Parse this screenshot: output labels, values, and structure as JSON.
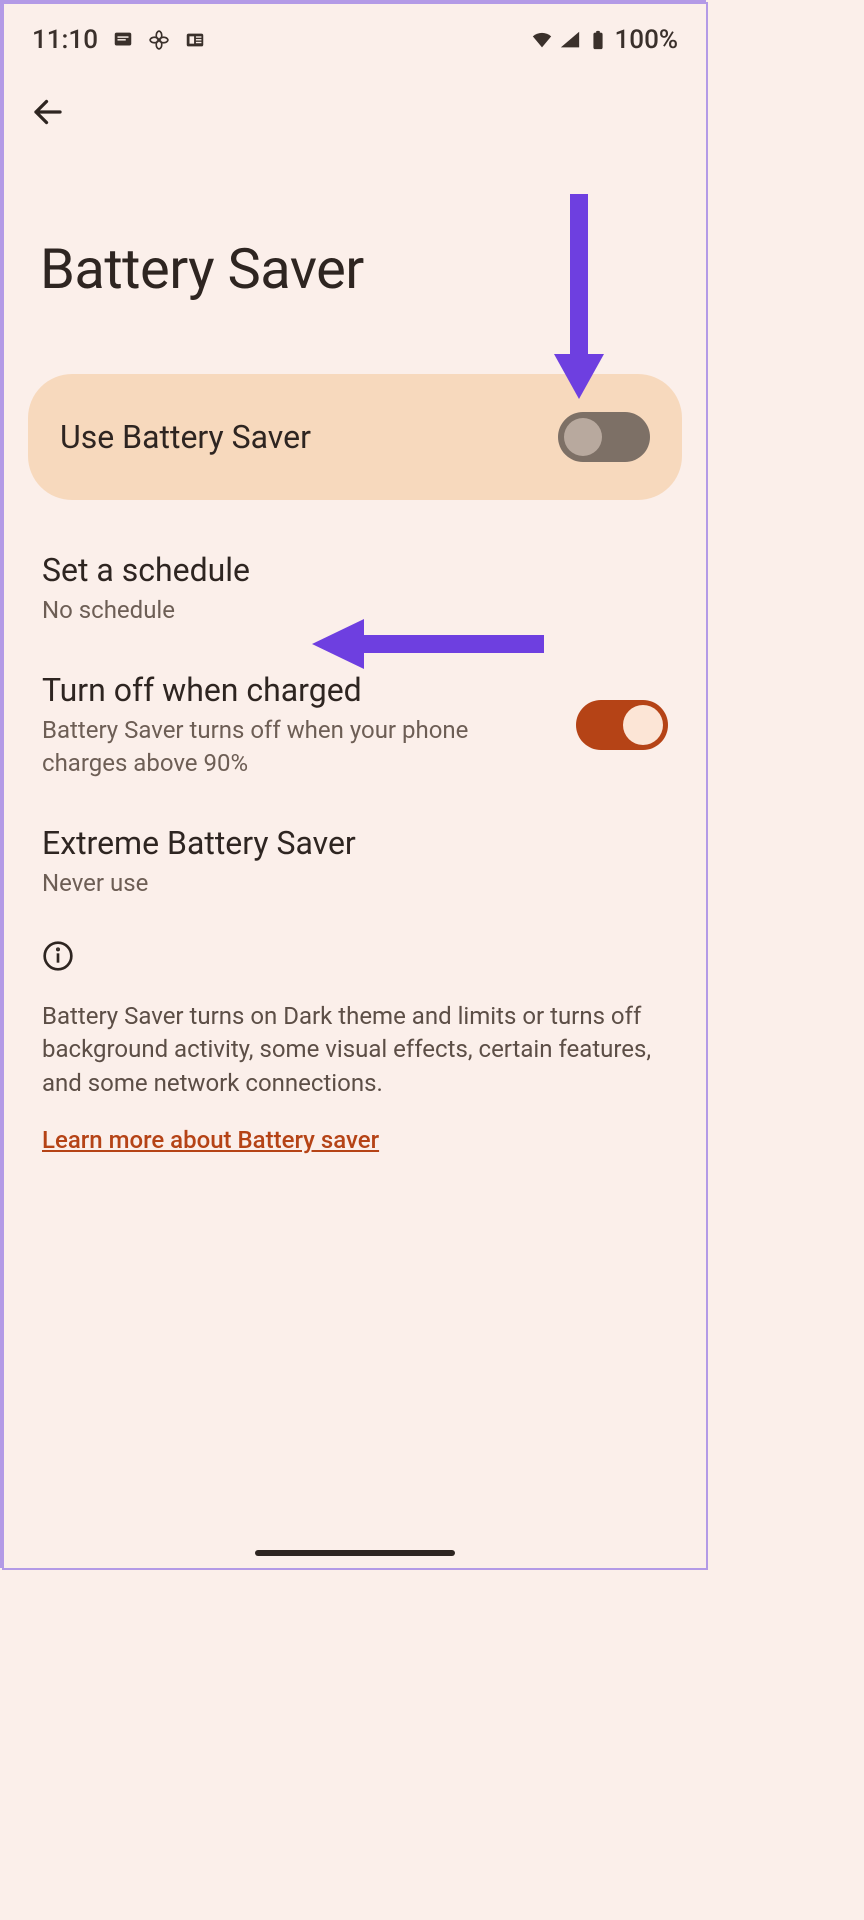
{
  "status": {
    "time": "11:10",
    "battery": "100%"
  },
  "header": {
    "title": "Battery Saver"
  },
  "main_toggle": {
    "label": "Use Battery Saver",
    "on": false
  },
  "items": {
    "schedule": {
      "title": "Set a schedule",
      "sub": "No schedule"
    },
    "turnoff": {
      "title": "Turn off when charged",
      "sub": "Battery Saver turns off when your phone charges above 90%",
      "on": true
    },
    "extreme": {
      "title": "Extreme Battery Saver",
      "sub": "Never use"
    }
  },
  "info": {
    "text": "Battery Saver turns on Dark theme and limits or turns off background activity, some visual effects, certain features, and some network connections.",
    "link": "Learn more about Battery saver"
  },
  "annotations": {
    "arrow1": "arrow-down-purple",
    "arrow2": "arrow-left-purple"
  }
}
